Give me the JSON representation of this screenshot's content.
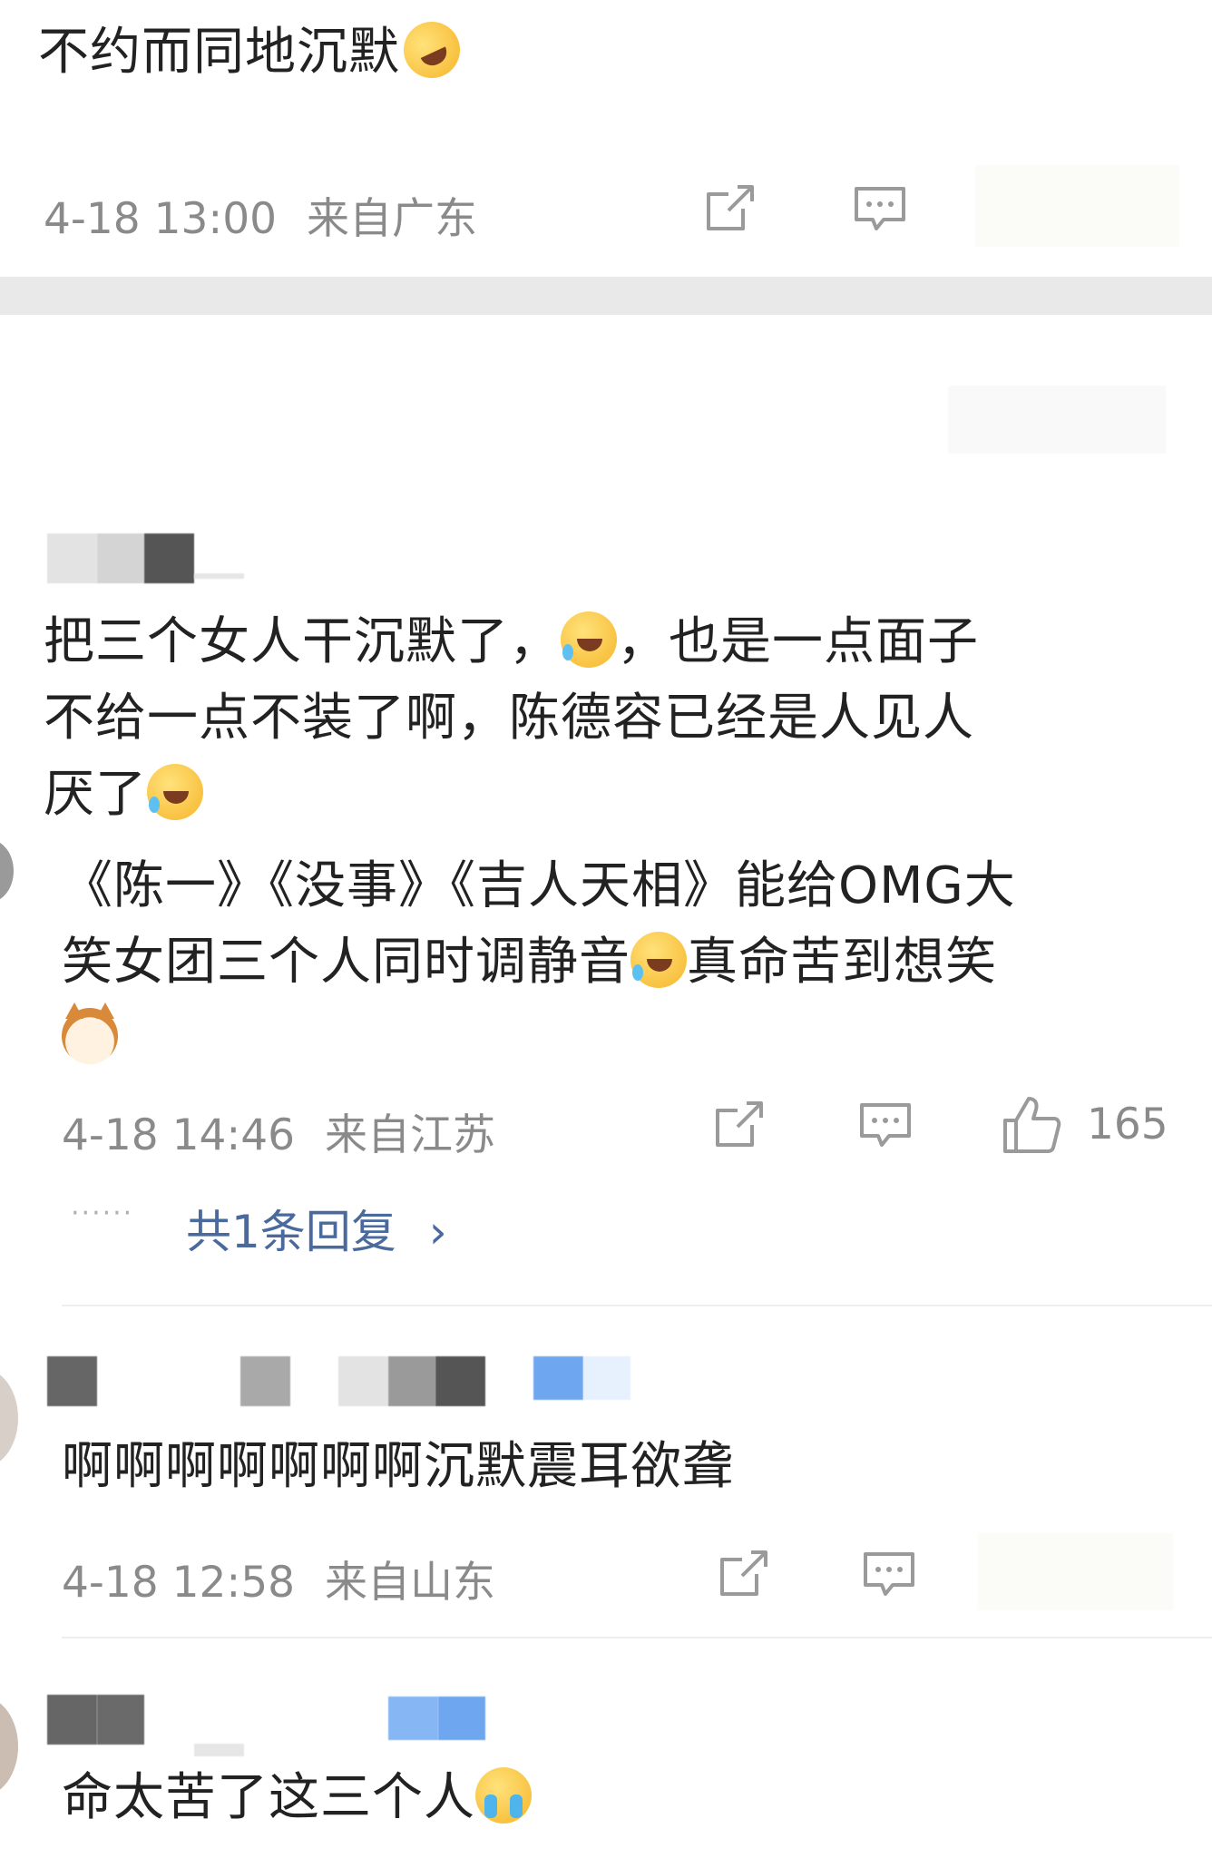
{
  "post": {
    "text": "不约而同地沉默",
    "emoji": "rofl-emoji",
    "time": "4-18 13:00",
    "location": "来自广东"
  },
  "comment1": {
    "text_line1_a": "把三个女人干沉默了，",
    "text_line1_b": "，也是一点面子",
    "text_line2": "不给一点不装了啊，陈德容已经是人见人",
    "text_line3": "厌了",
    "quote_line1": "《陈一》《没事》《吉人天相》能给OMG大",
    "quote_line2_a": "笑女团三个人同时调静音",
    "quote_line2_b": "真命苦到想笑",
    "time": "4-18 14:46",
    "location": "来自江苏",
    "likes": "165",
    "replies_dots": "······",
    "replies_link": "共1条回复",
    "replies_chevron": "›"
  },
  "comment2": {
    "text": "啊啊啊啊啊啊啊沉默震耳欲聋",
    "time": "4-18 12:58",
    "location": "来自山东"
  },
  "comment3": {
    "text": "命太苦了这三个人"
  },
  "colors": {
    "meta": "#8a8a8a",
    "link": "#4a6a9e",
    "divider": "#eeeeee",
    "icon": "#9a9a9a"
  }
}
